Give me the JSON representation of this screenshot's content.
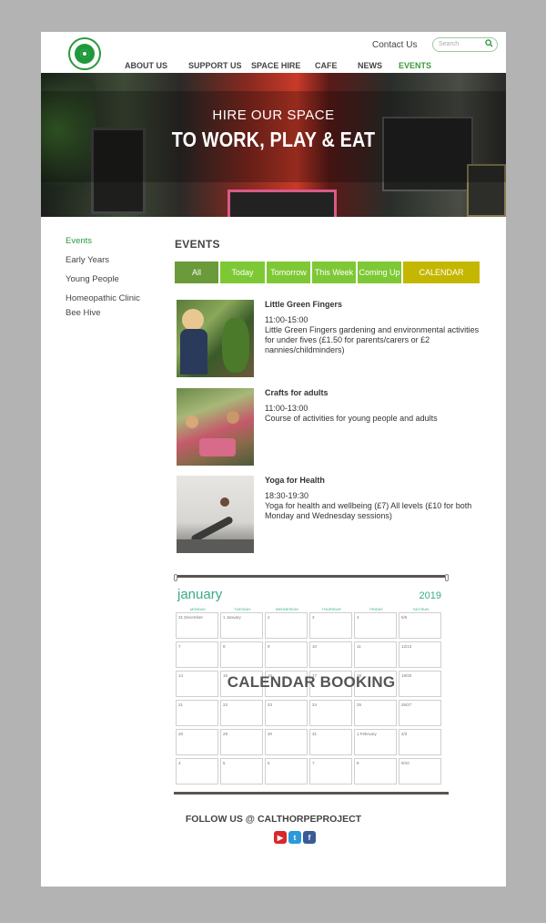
{
  "header": {
    "contact_label": "Contact Us",
    "search_placeholder": "Search",
    "nav": [
      {
        "label": "ABOUT US"
      },
      {
        "label": "SUPPORT US"
      },
      {
        "label": "SPACE HIRE"
      },
      {
        "label": "CAFE"
      },
      {
        "label": "NEWS"
      },
      {
        "label": "EVENTS"
      }
    ]
  },
  "hero": {
    "subtitle": "HIRE OUR SPACE",
    "title": "TO WORK, PLAY & EAT"
  },
  "sidebar": {
    "items": [
      {
        "label": "Events"
      },
      {
        "label": "Early Years"
      },
      {
        "label": "Young People"
      },
      {
        "label": "Homeopathic Clinic"
      },
      {
        "label": "Bee Hive"
      }
    ]
  },
  "main": {
    "title": "EVENTS",
    "filters": [
      {
        "label": "All"
      },
      {
        "label": "Today"
      },
      {
        "label": "Tomorrow"
      },
      {
        "label": "This Week"
      },
      {
        "label": "Coming Up"
      },
      {
        "label": "CALENDAR"
      }
    ],
    "events": [
      {
        "title": "Little Green Fingers",
        "time": "11:00-15:00",
        "description": "Little Green Fingers gardening and environmental activities for under fives (£1.50 for parents/carers or £2 nannies/childminders)"
      },
      {
        "title": "Crafts for adults",
        "time": "11:00-13:00",
        "description": "Course of activities for young people and adults"
      },
      {
        "title": "Yoga for Health",
        "time": "18:30-19:30",
        "description": "Yoga for health and wellbeing (£7) All levels  (£10 for both Monday and Wednesday sessions)"
      }
    ]
  },
  "calendar": {
    "month": "january",
    "year": "2019",
    "days": [
      "MONDAY",
      "TUESDAY",
      "WEDNESDAY",
      "THURSDAY",
      "FRIDAY",
      "SAT/SUN"
    ],
    "cells": [
      [
        "31 December",
        "1 January",
        "2",
        "3",
        "4",
        "5/6"
      ],
      [
        "7",
        "8",
        "9",
        "10",
        "11",
        "12/13"
      ],
      [
        "14",
        "15",
        "16",
        "17",
        "18",
        "19/20"
      ],
      [
        "21",
        "22",
        "23",
        "24",
        "25",
        "26/27"
      ],
      [
        "28",
        "29",
        "30",
        "31",
        "1 February",
        "2/3"
      ],
      [
        "4",
        "5",
        "6",
        "7",
        "8",
        "9/10"
      ]
    ],
    "overlay_label": "CALENDAR BOOKING"
  },
  "footer": {
    "follow_label": "FOLLOW US @ CALTHORPEPROJECT",
    "social": [
      "youtube-icon",
      "twitter-icon",
      "facebook-icon"
    ]
  },
  "colors": {
    "brand_green": "#2a9a3a",
    "filter_dark": "#6a9a3a",
    "filter_light": "#7ec836",
    "filter_calendar": "#c4b700",
    "background": "#b3b3b3"
  }
}
